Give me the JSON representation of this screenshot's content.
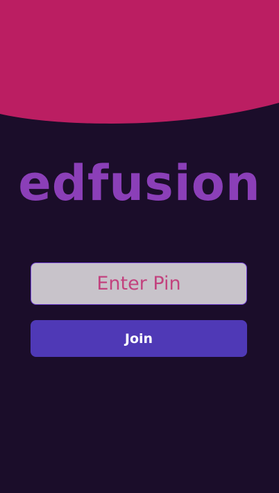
{
  "brand": {
    "name": "edfusion"
  },
  "join_form": {
    "pin_placeholder": "Enter Pin",
    "pin_value": "",
    "join_label": "Join"
  },
  "colors": {
    "background": "#1b0d2a",
    "top_wave": "#bb1e62",
    "logo": "#8b3fb8",
    "input_bg": "#c8c3ca",
    "input_text": "#c2427e",
    "input_border": "#6f3fd0",
    "button_bg": "#4f39b6",
    "button_text": "#ffffff"
  }
}
